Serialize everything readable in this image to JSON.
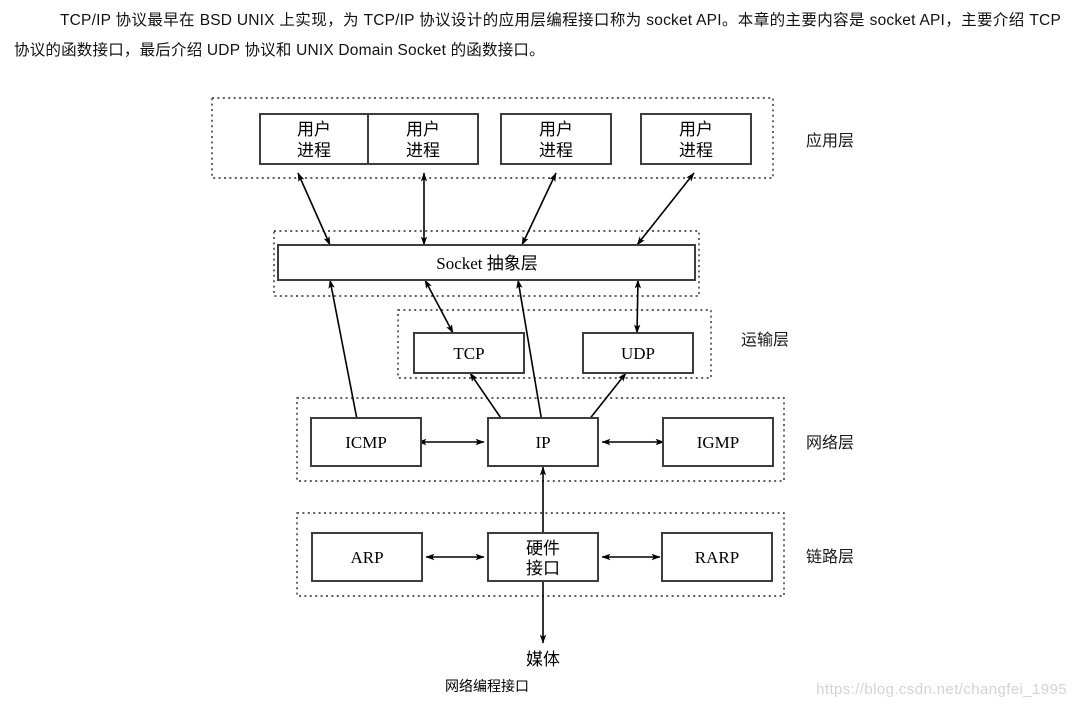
{
  "intro": {
    "paragraph": "TCP/IP 协议最早在 BSD UNIX 上实现，为 TCP/IP 协议设计的应用层编程接口称为 socket API。本章的主要内容是 socket API，主要介绍 TCP 协议的函数接口，最后介绍 UDP 协议和 UNIX Domain Socket 的函数接口。"
  },
  "diagram": {
    "caption": "网络编程接口",
    "media_label": "媒体",
    "layers": [
      {
        "id": "application",
        "label": "应用层"
      },
      {
        "id": "transport",
        "label": "运输层"
      },
      {
        "id": "network",
        "label": "网络层"
      },
      {
        "id": "link",
        "label": "链路层"
      }
    ],
    "nodes": [
      {
        "id": "user-process-1",
        "line1": "用户",
        "line2": "进程",
        "layer": "application"
      },
      {
        "id": "user-process-2",
        "line1": "用户",
        "line2": "进程",
        "layer": "application"
      },
      {
        "id": "user-process-3",
        "line1": "用户",
        "line2": "进程",
        "layer": "application"
      },
      {
        "id": "user-process-4",
        "line1": "用户",
        "line2": "进程",
        "layer": "application"
      },
      {
        "id": "socket-abstraction",
        "label": "Socket 抽象层",
        "layer": "socket"
      },
      {
        "id": "tcp",
        "label": "TCP",
        "layer": "transport"
      },
      {
        "id": "udp",
        "label": "UDP",
        "layer": "transport"
      },
      {
        "id": "icmp",
        "label": "ICMP",
        "layer": "network"
      },
      {
        "id": "ip",
        "label": "IP",
        "layer": "network"
      },
      {
        "id": "igmp",
        "label": "IGMP",
        "layer": "network"
      },
      {
        "id": "arp",
        "label": "ARP",
        "layer": "link"
      },
      {
        "id": "hardware-interface",
        "line1": "硬件",
        "line2": "接口",
        "layer": "link"
      },
      {
        "id": "rarp",
        "label": "RARP",
        "layer": "link"
      }
    ],
    "connections": [
      {
        "from": "user-process-1",
        "to": "socket-abstraction",
        "arrows": "both"
      },
      {
        "from": "user-process-2",
        "to": "socket-abstraction",
        "arrows": "both"
      },
      {
        "from": "user-process-3",
        "to": "socket-abstraction",
        "arrows": "both"
      },
      {
        "from": "user-process-4",
        "to": "socket-abstraction",
        "arrows": "both"
      },
      {
        "from": "socket-abstraction",
        "to": "icmp",
        "arrows": "both"
      },
      {
        "from": "socket-abstraction",
        "to": "tcp",
        "arrows": "both"
      },
      {
        "from": "socket-abstraction",
        "to": "ip",
        "arrows": "both"
      },
      {
        "from": "socket-abstraction",
        "to": "udp",
        "arrows": "both"
      },
      {
        "from": "tcp",
        "to": "ip",
        "arrows": "both"
      },
      {
        "from": "udp",
        "to": "ip",
        "arrows": "both"
      },
      {
        "from": "icmp",
        "to": "ip",
        "arrows": "both"
      },
      {
        "from": "ip",
        "to": "igmp",
        "arrows": "both"
      },
      {
        "from": "ip",
        "to": "hardware-interface",
        "arrows": "both"
      },
      {
        "from": "arp",
        "to": "hardware-interface",
        "arrows": "both"
      },
      {
        "from": "hardware-interface",
        "to": "rarp",
        "arrows": "both"
      },
      {
        "from": "hardware-interface",
        "to": "media",
        "arrows": "down"
      }
    ]
  },
  "watermark": {
    "text": "https://blog.csdn.net/changfei_1995"
  },
  "colors": {
    "background": "#ffffff",
    "node_stroke": "#3d3d3d",
    "group_stroke": "#2b2b2b",
    "connector": "#000000",
    "watermark": "#d3d3d3"
  }
}
